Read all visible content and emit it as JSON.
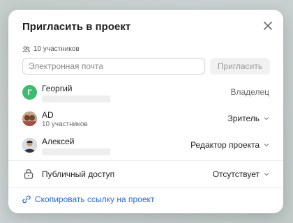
{
  "dialog": {
    "title": "Пригласить в проект",
    "members_count": "10 участников",
    "email_placeholder": "Электронная почта",
    "invite_label": "Пригласить"
  },
  "members": [
    {
      "name": "Георгий",
      "subtitle": "",
      "role": "Владелец",
      "avatar_letter": "Г",
      "avatar_color": "#3dbb6e",
      "role_dropdown": false
    },
    {
      "name": "AD",
      "subtitle": "10 участников",
      "role": "Зритель",
      "avatar_letter": "",
      "avatar_color": "#8a5a44",
      "role_dropdown": true
    },
    {
      "name": "Алексей",
      "subtitle": "",
      "role": "Редактор проекта",
      "avatar_letter": "",
      "avatar_color": "#3a4250",
      "role_dropdown": true
    }
  ],
  "public_access": {
    "label": "Публичный доступ",
    "value": "Отсутствует"
  },
  "copy_link_label": "Скопировать ссылку на проект",
  "colors": {
    "accent": "#2f6ad9",
    "owner_avatar": "#3dbb6e"
  }
}
